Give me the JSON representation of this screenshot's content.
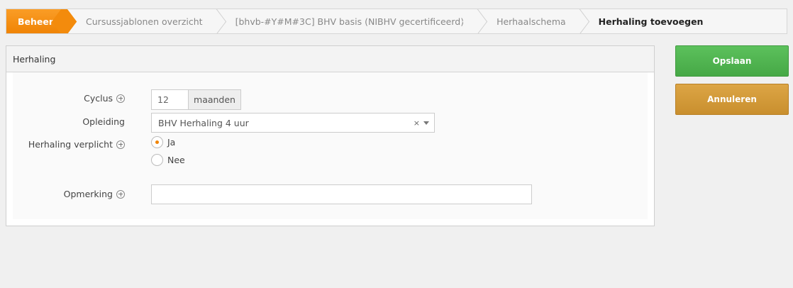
{
  "breadcrumb": {
    "items": [
      {
        "label": "Beheer"
      },
      {
        "label": "Cursussjablonen overzicht"
      },
      {
        "label": "[bhvb-#Y#M#3C] BHV basis (NIBHV gecertificeerd)"
      },
      {
        "label": "Herhaalschema"
      },
      {
        "label": "Herhaling toevoegen"
      }
    ]
  },
  "panel": {
    "title": "Herhaling",
    "cyclus": {
      "label": "Cyclus",
      "value": "12",
      "unit": "maanden"
    },
    "opleiding": {
      "label": "Opleiding",
      "value": "BHV Herhaling 4 uur",
      "clear": "×"
    },
    "verplicht": {
      "label": "Herhaling verplicht",
      "options": [
        "Ja",
        "Nee"
      ],
      "selected": "Ja"
    },
    "opmerking": {
      "label": "Opmerking",
      "value": ""
    }
  },
  "actions": {
    "save_label": "Opslaan",
    "cancel_label": "Annuleren"
  },
  "colors": {
    "accent": "#f08405",
    "save": "#4cb04c",
    "cancel": "#d29a38"
  }
}
